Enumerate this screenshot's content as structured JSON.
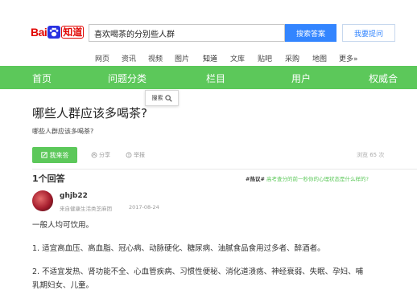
{
  "header": {
    "logo_prefix": "Bai",
    "logo_suffix": "知道",
    "search_value": "喜欢喝茶的分别些人群",
    "search_button": "搜索答案",
    "ask_button": "我要提问"
  },
  "catnav": [
    "网页",
    "资讯",
    "视频",
    "图片",
    "知道",
    "文库",
    "贴吧",
    "采购",
    "地图",
    "更多»"
  ],
  "greenbar": [
    "首页",
    "问题分类",
    "栏目",
    "用户",
    "权威合"
  ],
  "chip_label": "搜索",
  "question": {
    "title": "哪些人群应该多喝茶?",
    "description": "哪些人群应该多喝茶?",
    "answer_button": "我来答",
    "share": "分享",
    "report": "举报",
    "views": "浏览 65 次"
  },
  "answers": {
    "count": "1个回答",
    "promo_tag": "#热议#",
    "promo_text": "高考查分的前一秒你的心理状态是什么样的?"
  },
  "answer": {
    "username": "ghjb22",
    "user_sub": "来自健康生活类芝麻团",
    "date": "2017-08-24",
    "p1": "一般人均可饮用。",
    "p2": "1. 适宜高血压、高血脂、冠心病、动脉硬化、糖尿病、油腻食品食用过多者、醉酒者。",
    "p3a": "2. 不适宜发热、肾功能不全、心血管疾病、习惯性便秘、消化道溃疡、神经衰弱、失眠、孕妇、哺",
    "p3b": "乳期妇女、儿童。"
  },
  "colors": {
    "brand_green": "#5cc85a",
    "baidu_red": "#e10602",
    "baidu_blue": "#3385ff"
  }
}
